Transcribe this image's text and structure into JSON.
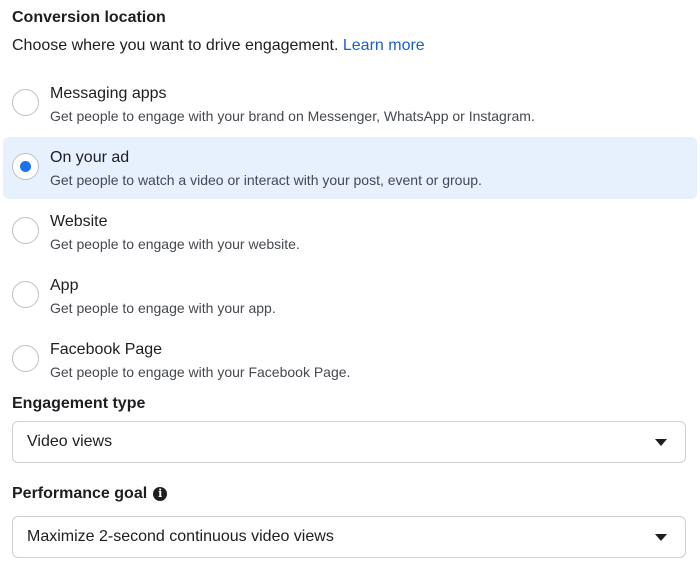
{
  "conversion_location": {
    "title": "Conversion location",
    "subtitle": "Choose where you want to drive engagement.",
    "learn_more": "Learn more",
    "options": [
      {
        "label": "Messaging apps",
        "description": "Get people to engage with your brand on Messenger, WhatsApp or Instagram.",
        "selected": false
      },
      {
        "label": "On your ad",
        "description": "Get people to watch a video or interact with your post, event or group.",
        "selected": true
      },
      {
        "label": "Website",
        "description": "Get people to engage with your website.",
        "selected": false
      },
      {
        "label": "App",
        "description": "Get people to engage with your app.",
        "selected": false
      },
      {
        "label": "Facebook Page",
        "description": "Get people to engage with your Facebook Page.",
        "selected": false
      }
    ]
  },
  "engagement_type": {
    "title": "Engagement type",
    "selected_value": "Video views"
  },
  "performance_goal": {
    "title": "Performance goal",
    "info_icon": "i",
    "selected_value": "Maximize 2-second continuous video views"
  },
  "colors": {
    "accent": "#1b74e4",
    "selected_bg": "#e7f0fd",
    "link": "#1a5fd1"
  }
}
